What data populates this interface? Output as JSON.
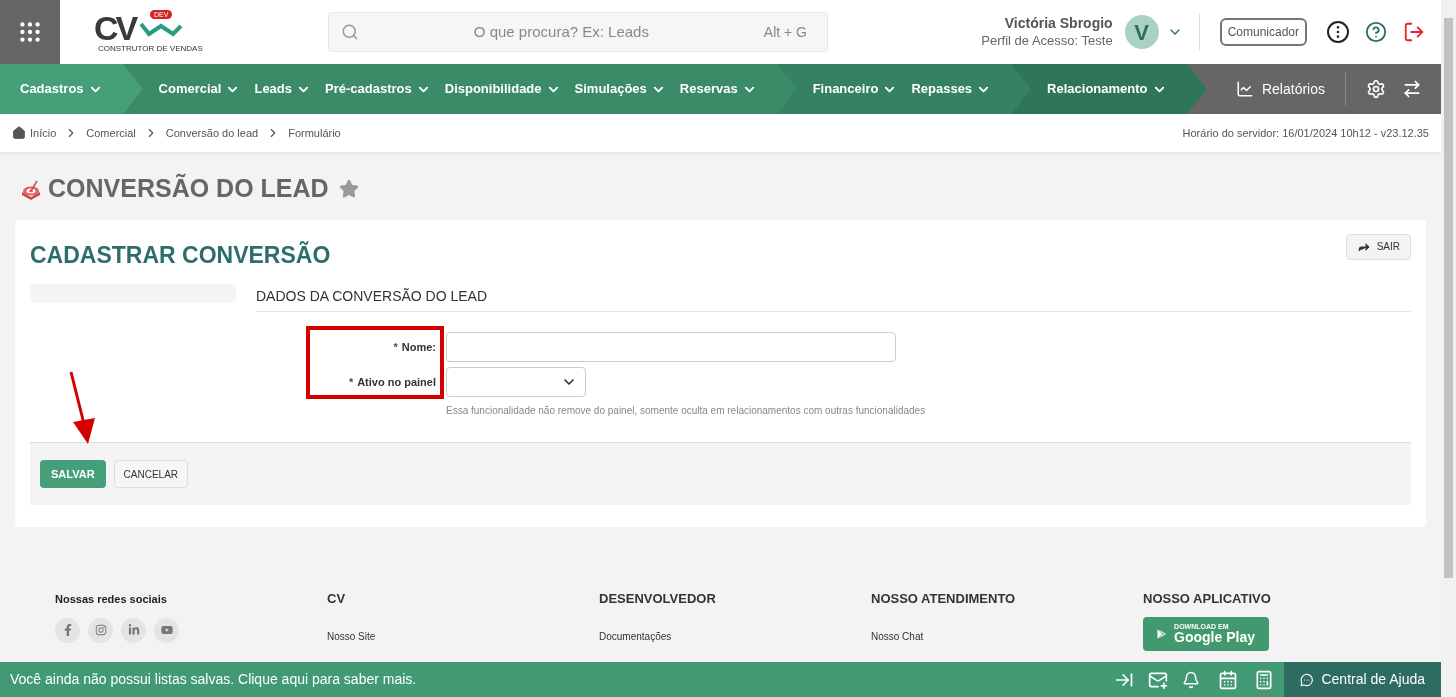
{
  "header": {
    "logo": {
      "letters": "CV",
      "badge": "DEV",
      "caption": "CONSTRUTOR DE VENDAS"
    },
    "search": {
      "placeholder": "O que procura? Ex: Leads",
      "shortcut": "Alt + G"
    },
    "user": {
      "name": "Victória Sbrogio",
      "profile": "Perfil de Acesso: Teste",
      "initial": "V"
    },
    "communicator_button": "Comunicador"
  },
  "nav": {
    "groups": [
      {
        "items": [
          "Cadastros"
        ]
      },
      {
        "items": [
          "Comercial",
          "Leads",
          "Pré-cadastros",
          "Disponibilidade",
          "Simulações",
          "Reservas"
        ]
      },
      {
        "items": [
          "Financeiro",
          "Repasses"
        ]
      },
      {
        "items": [
          "Relacionamento"
        ]
      }
    ],
    "reports": "Relatórios"
  },
  "breadcrumb": [
    "Início",
    "Comercial",
    "Conversão do lead",
    "Formulário"
  ],
  "server_time": "Horário do servidor: 16/01/2024 10h12 - v23.12.35",
  "page_title": "CONVERSÃO DO LEAD",
  "form": {
    "title": "CADASTRAR CONVERSÃO",
    "exit_button": "SAIR",
    "section": "DADOS DA CONVERSÃO DO LEAD",
    "fields": [
      {
        "kind": "text",
        "marker": "*",
        "label": "Nome:"
      },
      {
        "kind": "select",
        "marker": "*",
        "label": "Ativo no painel",
        "hint": "Essa funcionalidade não remove do painel, somente oculta em relacionamentos com outras funcionalidades"
      }
    ],
    "buttons": [
      {
        "label": "SALVAR",
        "primary": true
      },
      {
        "label": "CANCELAR",
        "primary": false
      }
    ]
  },
  "footer": {
    "columns": [
      {
        "kind": "social",
        "title": "Nossas redes sociais"
      },
      {
        "kind": "links",
        "title": "CV",
        "links": [
          "Nosso Site"
        ]
      },
      {
        "kind": "links",
        "title": "DESENVOLVEDOR",
        "links": [
          "Documentações"
        ]
      },
      {
        "kind": "links",
        "title": "NOSSO ATENDIMENTO",
        "links": [
          "Nosso Chat"
        ]
      },
      {
        "kind": "app",
        "title": "NOSSO APLICATIVO",
        "store_small": "DOWNLOAD EM",
        "store_big": "Google Play"
      }
    ]
  },
  "bottom_bar": {
    "message": "Você ainda não possui listas salvas. Clique aqui para saber mais.",
    "help": "Central de Ajuda"
  }
}
